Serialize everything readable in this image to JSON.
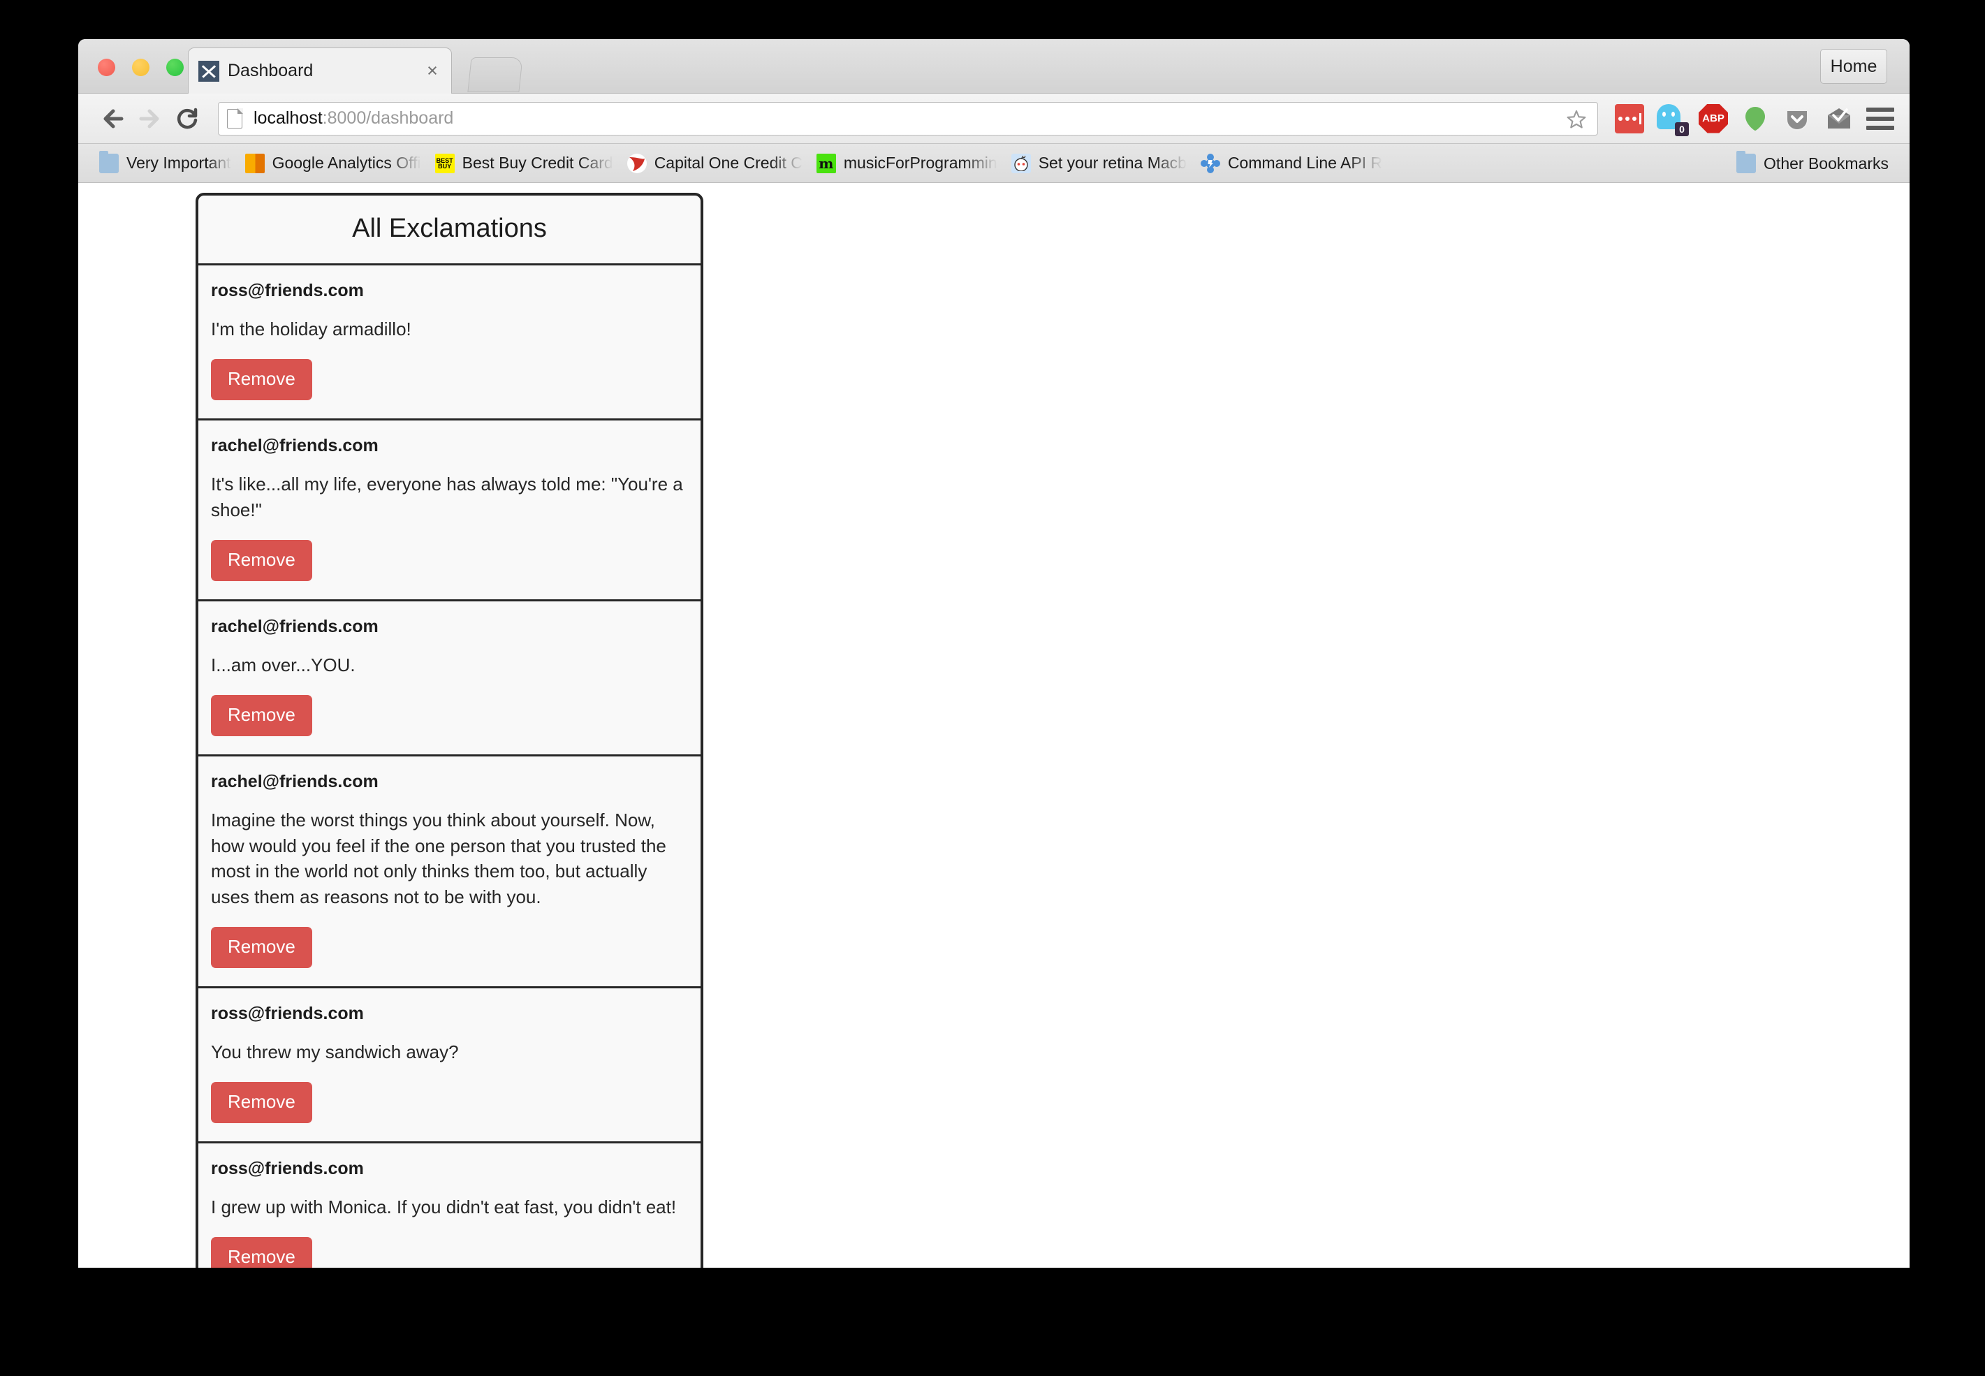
{
  "window": {
    "home_button": "Home"
  },
  "tab": {
    "title": "Dashboard",
    "favicon": "bowtie-favicon",
    "close": "×"
  },
  "toolbar": {
    "back": "back-arrow-icon",
    "forward": "forward-arrow-icon",
    "reload": "reload-icon",
    "url_host": "localhost",
    "url_path": ":8000/dashboard",
    "star": "star-icon",
    "extensions": [
      {
        "name": "lastpass-icon",
        "label": ""
      },
      {
        "name": "ghostery-icon",
        "badge": "0"
      },
      {
        "name": "adblock-plus-icon",
        "label": "ABP"
      },
      {
        "name": "evernote-icon",
        "label": ""
      },
      {
        "name": "pocket-icon",
        "label": ""
      },
      {
        "name": "mailbox-icon",
        "label": ""
      }
    ],
    "menu": "hamburger-menu-icon"
  },
  "bookmarks": {
    "items": [
      {
        "label": "Very Important",
        "icon": "folder-icon"
      },
      {
        "label": "Google Analytics Offi",
        "icon": "google-analytics-icon"
      },
      {
        "label": "Best Buy Credit Card",
        "icon": "bestbuy-icon"
      },
      {
        "label": "Capital One Credit C",
        "icon": "capitalone-icon"
      },
      {
        "label": "musicForProgrammin",
        "icon": "musicforprogramming-icon"
      },
      {
        "label": "Set your retina Macb",
        "icon": "reddit-icon"
      },
      {
        "label": "Command Line API R",
        "icon": "blue-flower-icon"
      }
    ],
    "other_label": "Other Bookmarks",
    "other_icon": "folder-icon"
  },
  "page": {
    "panel_title": "All Exclamations",
    "remove_label": "Remove",
    "exclamations": [
      {
        "email": "ross@friends.com",
        "text": "I'm the holiday armadillo!"
      },
      {
        "email": "rachel@friends.com",
        "text": "It's like...all my life, everyone has always told me: \"You're a shoe!\""
      },
      {
        "email": "rachel@friends.com",
        "text": "I...am over...YOU."
      },
      {
        "email": "rachel@friends.com",
        "text": "Imagine the worst things you think about yourself. Now, how would you feel if the one person that you trusted the most in the world not only thinks them too, but actually uses them as reasons not to be with you."
      },
      {
        "email": "ross@friends.com",
        "text": "You threw my sandwich away?"
      },
      {
        "email": "ross@friends.com",
        "text": "I grew up with Monica. If you didn't eat fast, you didn't eat!"
      }
    ]
  },
  "colors": {
    "danger": "#d9534f",
    "panel_border": "#262626",
    "favicon": "#3f5268"
  }
}
